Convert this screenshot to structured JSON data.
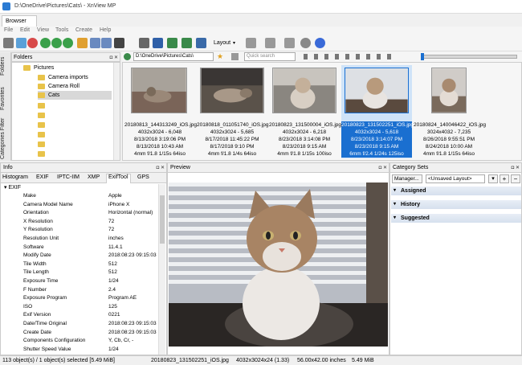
{
  "window": {
    "title": "D:\\OneDrive\\Pictures\\Cats\\ - XnView MP"
  },
  "tabs": [
    "Browser"
  ],
  "menu": [
    "File",
    "Edit",
    "View",
    "Tools",
    "Create",
    "Help"
  ],
  "toolbar": {
    "layout_label": "Layout"
  },
  "folders": {
    "header": "Folders",
    "side_tabs": [
      "Folders",
      "Favorites",
      "Categories Filter"
    ],
    "tree": [
      "Pictures",
      "Camera imports",
      "Camera Roll",
      "Cats"
    ]
  },
  "pathbar": {
    "path": "D:\\OneDrive\\Pictures\\Cats\\",
    "search_placeholder": "Quick search"
  },
  "thumbnails": [
    {
      "name": "20180813_144313249_iOS.jpg",
      "dims": "4032x3024 - 6,048",
      "date1": "8/13/2018 3:19:06 PM",
      "date2": "8/13/2018 10:43 AM",
      "exif": "4mm f/1.8 1/15s 64iso",
      "selected": false
    },
    {
      "name": "20180818_011051740_iOS.jpg",
      "dims": "4032x3024 - 5,685",
      "date1": "8/17/2018 11:45:22 PM",
      "date2": "8/17/2018 9:10 PM",
      "exif": "4mm f/1.8 1/4s 64iso",
      "selected": false
    },
    {
      "name": "20180823_131500004_iOS.jpg",
      "dims": "4032x3024 - 6,218",
      "date1": "8/23/2018 3:14:08 PM",
      "date2": "8/23/2018 9:15 AM",
      "exif": "4mm f/1.8 1/15s 100iso",
      "selected": false
    },
    {
      "name": "20180823_131502251_iOS.jpg",
      "dims": "4032x3024 - 5,618",
      "date1": "8/23/2018 3:14:07 PM",
      "date2": "8/23/2018 9:15 AM",
      "exif": "6mm f/2.4 1/24s 125iso",
      "selected": true
    },
    {
      "name": "20180824_140046422_iOS.jpg",
      "dims": "3024x4032 - 7,235",
      "date1": "8/26/2018 9:55:51 PM",
      "date2": "8/24/2018 10:00 AM",
      "exif": "4mm f/1.8 1/15s 64iso",
      "selected": false
    }
  ],
  "info": {
    "header": "Info",
    "tabs": [
      "Histogram",
      "EXIF",
      "IPTC-IIM",
      "XMP",
      "ExifTool",
      "GPS"
    ],
    "active_tab": "ExifTool",
    "group": "EXIF",
    "rows": [
      {
        "k": "Make",
        "v": "Apple"
      },
      {
        "k": "Camera Model Name",
        "v": "iPhone X"
      },
      {
        "k": "Orientation",
        "v": "Horizontal (normal)"
      },
      {
        "k": "X Resolution",
        "v": "72"
      },
      {
        "k": "Y Resolution",
        "v": "72"
      },
      {
        "k": "Resolution Unit",
        "v": "inches"
      },
      {
        "k": "Software",
        "v": "11.4.1"
      },
      {
        "k": "Modify Date",
        "v": "2018:08:23 09:15:03"
      },
      {
        "k": "Tile Width",
        "v": "512"
      },
      {
        "k": "Tile Length",
        "v": "512"
      },
      {
        "k": "Exposure Time",
        "v": "1/24"
      },
      {
        "k": "F Number",
        "v": "2.4"
      },
      {
        "k": "Exposure Program",
        "v": "Program AE"
      },
      {
        "k": "ISO",
        "v": "125"
      },
      {
        "k": "Exif Version",
        "v": "0221"
      },
      {
        "k": "Date/Time Original",
        "v": "2018:08:23 09:15:03"
      },
      {
        "k": "Create Date",
        "v": "2018:08:23 09:15:03"
      },
      {
        "k": "Components Configuration",
        "v": "Y, Cb, Cr, -"
      },
      {
        "k": "Shutter Speed Value",
        "v": "1/24"
      }
    ]
  },
  "preview": {
    "header": "Preview"
  },
  "category": {
    "header": "Category Sets",
    "manager_label": "Manager...",
    "layout_select": "<Unsaved Layout>",
    "sections": [
      "Assigned",
      "History",
      "Suggested"
    ]
  },
  "status": {
    "selection": "113 object(s) / 1 object(s) selected [5.49 MiB]",
    "filename": "20180823_131502251_iOS.jpg",
    "dims": "4032x3024x24 (1.33)",
    "inches": "56.00x42.00 inches",
    "size": "5.49 MiB"
  }
}
